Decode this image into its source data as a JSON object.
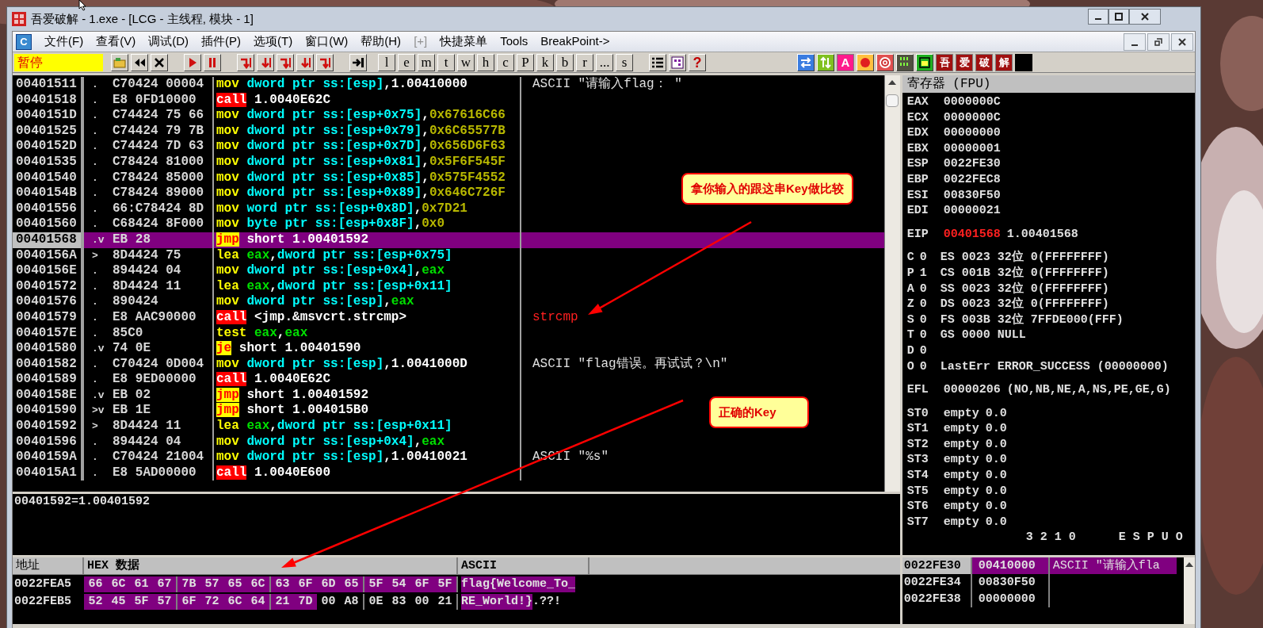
{
  "window": {
    "title": "吾爱破解 - 1.exe - [LCG -  主线程, 模块 - 1]"
  },
  "menu": {
    "app_icon": "C",
    "items": [
      {
        "label": "文件(F)",
        "disabled": false
      },
      {
        "label": "查看(V)",
        "disabled": false
      },
      {
        "label": "调试(D)",
        "disabled": false
      },
      {
        "label": "插件(P)",
        "disabled": false
      },
      {
        "label": "选项(T)",
        "disabled": false
      },
      {
        "label": "窗口(W)",
        "disabled": false
      },
      {
        "label": "帮助(H)",
        "disabled": false
      },
      {
        "label": "[+]",
        "disabled": true
      },
      {
        "label": "快捷菜单",
        "disabled": false
      },
      {
        "label": "Tools",
        "disabled": false
      },
      {
        "label": "BreakPoint->",
        "disabled": false
      }
    ]
  },
  "toolbar": {
    "status": "暂停",
    "letter_buttons": [
      "l",
      "e",
      "m",
      "t",
      "w",
      "h",
      "c",
      "P",
      "k",
      "b",
      "r",
      "...",
      "s"
    ],
    "help": "?",
    "text_button": "A",
    "brand_buttons": [
      "吾",
      "爱",
      "破",
      "解"
    ]
  },
  "disassembly": {
    "rows": [
      {
        "address": "00401511",
        "mark": ".",
        "bytes": "C70424 00004",
        "selected": false,
        "mnemonic": {
          "text": "mov",
          "kind": "plain"
        },
        "operands": [
          {
            "text": "dword ptr ss:[esp]",
            "kind": "memory"
          },
          {
            "text": ",",
            "kind": "plain"
          },
          {
            "text": "1.00410000",
            "kind": "address"
          }
        ],
        "comment": {
          "text": "ASCII \"请输入flag： \"",
          "kind": "string"
        }
      },
      {
        "address": "00401518",
        "mark": ".",
        "bytes": "E8 0FD10000",
        "selected": false,
        "mnemonic": {
          "text": "call",
          "kind": "call"
        },
        "operands": [
          {
            "text": "1.0040E62C",
            "kind": "address"
          }
        ]
      },
      {
        "address": "0040151D",
        "mark": ".",
        "bytes": "C74424 75 66",
        "selected": false,
        "mnemonic": {
          "text": "mov",
          "kind": "plain"
        },
        "operands": [
          {
            "text": "dword ptr ss:[esp+0x75]",
            "kind": "memory"
          },
          {
            "text": ",",
            "kind": "plain"
          },
          {
            "text": "0x67616C66",
            "kind": "constant"
          }
        ]
      },
      {
        "address": "00401525",
        "mark": ".",
        "bytes": "C74424 79 7B",
        "selected": false,
        "mnemonic": {
          "text": "mov",
          "kind": "plain"
        },
        "operands": [
          {
            "text": "dword ptr ss:[esp+0x79]",
            "kind": "memory"
          },
          {
            "text": ",",
            "kind": "plain"
          },
          {
            "text": "0x6C65577B",
            "kind": "constant"
          }
        ]
      },
      {
        "address": "0040152D",
        "mark": ".",
        "bytes": "C74424 7D 63",
        "selected": false,
        "mnemonic": {
          "text": "mov",
          "kind": "plain"
        },
        "operands": [
          {
            "text": "dword ptr ss:[esp+0x7D]",
            "kind": "memory"
          },
          {
            "text": ",",
            "kind": "plain"
          },
          {
            "text": "0x656D6F63",
            "kind": "constant"
          }
        ]
      },
      {
        "address": "00401535",
        "mark": ".",
        "bytes": "C78424 81000",
        "selected": false,
        "mnemonic": {
          "text": "mov",
          "kind": "plain"
        },
        "operands": [
          {
            "text": "dword ptr ss:[esp+0x81]",
            "kind": "memory"
          },
          {
            "text": ",",
            "kind": "plain"
          },
          {
            "text": "0x5F6F545F",
            "kind": "constant"
          }
        ]
      },
      {
        "address": "00401540",
        "mark": ".",
        "bytes": "C78424 85000",
        "selected": false,
        "mnemonic": {
          "text": "mov",
          "kind": "plain"
        },
        "operands": [
          {
            "text": "dword ptr ss:[esp+0x85]",
            "kind": "memory"
          },
          {
            "text": ",",
            "kind": "plain"
          },
          {
            "text": "0x575F4552",
            "kind": "constant"
          }
        ]
      },
      {
        "address": "0040154B",
        "mark": ".",
        "bytes": "C78424 89000",
        "selected": false,
        "mnemonic": {
          "text": "mov",
          "kind": "plain"
        },
        "operands": [
          {
            "text": "dword ptr ss:[esp+0x89]",
            "kind": "memory"
          },
          {
            "text": ",",
            "kind": "plain"
          },
          {
            "text": "0x646C726F",
            "kind": "constant"
          }
        ]
      },
      {
        "address": "00401556",
        "mark": ".",
        "bytes": "66:C78424 8D",
        "selected": false,
        "mnemonic": {
          "text": "mov",
          "kind": "plain"
        },
        "operands": [
          {
            "text": "word ptr ss:[esp+0x8D]",
            "kind": "memory"
          },
          {
            "text": ",",
            "kind": "plain"
          },
          {
            "text": "0x7D21",
            "kind": "constant"
          }
        ]
      },
      {
        "address": "00401560",
        "mark": ".",
        "bytes": "C68424 8F000",
        "selected": false,
        "mnemonic": {
          "text": "mov",
          "kind": "plain"
        },
        "operands": [
          {
            "text": "byte ptr ss:[esp+0x8F]",
            "kind": "memory"
          },
          {
            "text": ",",
            "kind": "plain"
          },
          {
            "text": "0x0",
            "kind": "constant"
          }
        ]
      },
      {
        "address": "00401568",
        "mark": ".v",
        "bytes": "EB 28",
        "selected": true,
        "mnemonic": {
          "text": "jmp",
          "kind": "jump"
        },
        "operands": [
          {
            "text": "short 1.00401592",
            "kind": "address"
          }
        ]
      },
      {
        "address": "0040156A",
        "mark": ">",
        "bytes": "8D4424 75",
        "selected": false,
        "mnemonic": {
          "text": "lea",
          "kind": "plain"
        },
        "operands": [
          {
            "text": "eax",
            "kind": "register"
          },
          {
            "text": ",",
            "kind": "plain"
          },
          {
            "text": "dword ptr ss:[esp+0x75]",
            "kind": "memory"
          }
        ]
      },
      {
        "address": "0040156E",
        "mark": ".",
        "bytes": "894424 04",
        "selected": false,
        "mnemonic": {
          "text": "mov",
          "kind": "plain"
        },
        "operands": [
          {
            "text": "dword ptr ss:[esp+0x4]",
            "kind": "memory"
          },
          {
            "text": ",",
            "kind": "plain"
          },
          {
            "text": "eax",
            "kind": "register"
          }
        ]
      },
      {
        "address": "00401572",
        "mark": ".",
        "bytes": "8D4424 11",
        "selected": false,
        "mnemonic": {
          "text": "lea",
          "kind": "plain"
        },
        "operands": [
          {
            "text": "eax",
            "kind": "register"
          },
          {
            "text": ",",
            "kind": "plain"
          },
          {
            "text": "dword ptr ss:[esp+0x11]",
            "kind": "memory"
          }
        ]
      },
      {
        "address": "00401576",
        "mark": ".",
        "bytes": "890424",
        "selected": false,
        "mnemonic": {
          "text": "mov",
          "kind": "plain"
        },
        "operands": [
          {
            "text": "dword ptr ss:[esp]",
            "kind": "memory"
          },
          {
            "text": ",",
            "kind": "plain"
          },
          {
            "text": "eax",
            "kind": "register"
          }
        ]
      },
      {
        "address": "00401579",
        "mark": ".",
        "bytes": "E8 AAC90000",
        "selected": false,
        "mnemonic": {
          "text": "call",
          "kind": "call"
        },
        "operands": [
          {
            "text": "<jmp.&msvcrt.strcmp>",
            "kind": "address"
          }
        ],
        "comment": {
          "text": "strcmp",
          "kind": "function"
        }
      },
      {
        "address": "0040157E",
        "mark": ".",
        "bytes": "85C0",
        "selected": false,
        "mnemonic": {
          "text": "test",
          "kind": "plain"
        },
        "operands": [
          {
            "text": "eax",
            "kind": "register"
          },
          {
            "text": ",",
            "kind": "plain"
          },
          {
            "text": "eax",
            "kind": "register"
          }
        ]
      },
      {
        "address": "00401580",
        "mark": ".v",
        "bytes": "74 0E",
        "selected": false,
        "mnemonic": {
          "text": "je",
          "kind": "jump"
        },
        "operands": [
          {
            "text": "short 1.00401590",
            "kind": "address"
          }
        ]
      },
      {
        "address": "00401582",
        "mark": ".",
        "bytes": "C70424 0D004",
        "selected": false,
        "mnemonic": {
          "text": "mov",
          "kind": "plain"
        },
        "operands": [
          {
            "text": "dword ptr ss:[esp]",
            "kind": "memory"
          },
          {
            "text": ",",
            "kind": "plain"
          },
          {
            "text": "1.0041000D",
            "kind": "address"
          }
        ],
        "comment": {
          "text": "ASCII \"flag错误。再试试？\\n\"",
          "kind": "string"
        }
      },
      {
        "address": "00401589",
        "mark": ".",
        "bytes": "E8 9ED00000",
        "selected": false,
        "mnemonic": {
          "text": "call",
          "kind": "call"
        },
        "operands": [
          {
            "text": "1.0040E62C",
            "kind": "address"
          }
        ]
      },
      {
        "address": "0040158E",
        "mark": ".v",
        "bytes": "EB 02",
        "selected": false,
        "mnemonic": {
          "text": "jmp",
          "kind": "jump"
        },
        "operands": [
          {
            "text": "short 1.00401592",
            "kind": "address"
          }
        ]
      },
      {
        "address": "00401590",
        "mark": ">v",
        "bytes": "EB 1E",
        "selected": false,
        "mnemonic": {
          "text": "jmp",
          "kind": "jump"
        },
        "operands": [
          {
            "text": "short 1.004015B0",
            "kind": "address"
          }
        ]
      },
      {
        "address": "00401592",
        "mark": ">",
        "bytes": "8D4424 11",
        "selected": false,
        "mnemonic": {
          "text": "lea",
          "kind": "plain"
        },
        "operands": [
          {
            "text": "eax",
            "kind": "register"
          },
          {
            "text": ",",
            "kind": "plain"
          },
          {
            "text": "dword ptr ss:[esp+0x11]",
            "kind": "memory"
          }
        ]
      },
      {
        "address": "00401596",
        "mark": ".",
        "bytes": "894424 04",
        "selected": false,
        "mnemonic": {
          "text": "mov",
          "kind": "plain"
        },
        "operands": [
          {
            "text": "dword ptr ss:[esp+0x4]",
            "kind": "memory"
          },
          {
            "text": ",",
            "kind": "plain"
          },
          {
            "text": "eax",
            "kind": "register"
          }
        ]
      },
      {
        "address": "0040159A",
        "mark": ".",
        "bytes": "C70424 21004",
        "selected": false,
        "mnemonic": {
          "text": "mov",
          "kind": "plain"
        },
        "operands": [
          {
            "text": "dword ptr ss:[esp]",
            "kind": "memory"
          },
          {
            "text": ",",
            "kind": "plain"
          },
          {
            "text": "1.00410021",
            "kind": "address"
          }
        ],
        "comment": {
          "text": "ASCII \"%s\"",
          "kind": "string"
        }
      },
      {
        "address": "004015A1",
        "mark": ".",
        "bytes": "E8 5AD00000",
        "selected": false,
        "mnemonic": {
          "text": "call",
          "kind": "call"
        },
        "operands": [
          {
            "text": "1.0040E600",
            "kind": "address"
          }
        ]
      }
    ]
  },
  "info": "00401592=1.00401592",
  "registers": {
    "title": "寄存器 (FPU)",
    "groups": [
      {
        "lines": [
          {
            "name": "EAX",
            "value": "0000000C",
            "changed": false
          },
          {
            "name": "ECX",
            "value": "0000000C",
            "changed": false
          },
          {
            "name": "EDX",
            "value": "00000000",
            "changed": false
          },
          {
            "name": "EBX",
            "value": "00000001",
            "changed": false
          },
          {
            "name": "ESP",
            "value": "0022FE30",
            "changed": false
          },
          {
            "name": "EBP",
            "value": "0022FEC8",
            "changed": false
          },
          {
            "name": "ESI",
            "value": "00830F50",
            "changed": false
          },
          {
            "name": "EDI",
            "value": "00000021",
            "changed": false
          }
        ]
      },
      {
        "lines": [
          {
            "name": "EIP",
            "value": "00401568",
            "rest": "1.00401568",
            "changed": true
          }
        ]
      },
      {
        "lines": [
          {
            "name": "C",
            "value": "0",
            "rest": " ES 0023 32位 0(FFFFFFFF)",
            "changed": false
          },
          {
            "name": "P",
            "value": "1",
            "rest": " CS 001B 32位 0(FFFFFFFF)",
            "changed": false
          },
          {
            "name": "A",
            "value": "0",
            "rest": " SS 0023 32位 0(FFFFFFFF)",
            "changed": false
          },
          {
            "name": "Z",
            "value": "0",
            "rest": " DS 0023 32位 0(FFFFFFFF)",
            "changed": false
          },
          {
            "name": "S",
            "value": "0",
            "rest": " FS 003B 32位 7FFDE000(FFF)",
            "changed": false
          },
          {
            "name": "T",
            "value": "0",
            "rest": " GS 0000 NULL",
            "changed": false
          },
          {
            "name": "D",
            "value": "0",
            "changed": false
          },
          {
            "name": "O",
            "value": "0",
            "rest": " LastErr ERROR_SUCCESS (00000000)",
            "changed": false
          }
        ]
      },
      {
        "lines": [
          {
            "name": "EFL",
            "value": "00000206",
            "rest": "(NO,NB,NE,A,NS,PE,GE,G)",
            "changed": false
          }
        ]
      },
      {
        "lines": [
          {
            "name": "ST0",
            "value": "empty",
            "rest": "0.0",
            "changed": false
          },
          {
            "name": "ST1",
            "value": "empty",
            "rest": "0.0",
            "changed": false
          },
          {
            "name": "ST2",
            "value": "empty",
            "rest": "0.0",
            "changed": false
          },
          {
            "name": "ST3",
            "value": "empty",
            "rest": "0.0",
            "changed": false
          },
          {
            "name": "ST4",
            "value": "empty",
            "rest": "0.0",
            "changed": false
          },
          {
            "name": "ST5",
            "value": "empty",
            "rest": "0.0",
            "changed": false
          },
          {
            "name": "ST6",
            "value": "empty",
            "rest": "0.0",
            "changed": false
          },
          {
            "name": "ST7",
            "value": "empty",
            "rest": "0.0",
            "changed": false
          }
        ]
      }
    ],
    "fpu_header": "3 2 1 0      E S P U O"
  },
  "dump": {
    "columns": [
      "地址",
      "HEX 数据",
      "ASCII"
    ],
    "rows": [
      {
        "address": "0022FEA5",
        "bytes": [
          {
            "text": "66",
            "selected": true
          },
          {
            "text": "6C",
            "selected": true
          },
          {
            "text": "61",
            "selected": true
          },
          {
            "text": "67",
            "selected": true
          },
          {
            "text": "7B",
            "selected": true
          },
          {
            "text": "57",
            "selected": true
          },
          {
            "text": "65",
            "selected": true
          },
          {
            "text": "6C",
            "selected": true
          },
          {
            "text": "63",
            "selected": true
          },
          {
            "text": "6F",
            "selected": true
          },
          {
            "text": "6D",
            "selected": true
          },
          {
            "text": "65",
            "selected": true
          },
          {
            "text": "5F",
            "selected": true
          },
          {
            "text": "54",
            "selected": true
          },
          {
            "text": "6F",
            "selected": true
          },
          {
            "text": "5F",
            "selected": true
          }
        ],
        "ascii": [
          {
            "text": "flag{Welcome_To_",
            "selected": true
          }
        ]
      },
      {
        "address": "0022FEB5",
        "bytes": [
          {
            "text": "52",
            "selected": true
          },
          {
            "text": "45",
            "selected": true
          },
          {
            "text": "5F",
            "selected": true
          },
          {
            "text": "57",
            "selected": true
          },
          {
            "text": "6F",
            "selected": true
          },
          {
            "text": "72",
            "selected": true
          },
          {
            "text": "6C",
            "selected": true
          },
          {
            "text": "64",
            "selected": true
          },
          {
            "text": "21",
            "selected": true
          },
          {
            "text": "7D",
            "selected": true
          },
          {
            "text": "00",
            "selected": false
          },
          {
            "text": "A8",
            "selected": false
          },
          {
            "text": "0E",
            "selected": false
          },
          {
            "text": "83",
            "selected": false
          },
          {
            "text": "00",
            "selected": false
          },
          {
            "text": "21",
            "selected": false
          }
        ],
        "ascii": [
          {
            "text": "RE_World!}",
            "selected": true
          },
          {
            "text": ".??!",
            "selected": false
          }
        ]
      }
    ]
  },
  "stack": {
    "rows": [
      {
        "address": "0022FE30",
        "value": "00410000",
        "comment": "ASCII \"请输入fla",
        "selected": true
      },
      {
        "address": "0022FE34",
        "value": "00830F50",
        "selected": false
      },
      {
        "address": "0022FE38",
        "value": "00000000",
        "selected": false
      }
    ]
  },
  "annotations": [
    {
      "text": "拿你输入的跟这串Key做比较"
    },
    {
      "text": "正确的Key"
    }
  ]
}
